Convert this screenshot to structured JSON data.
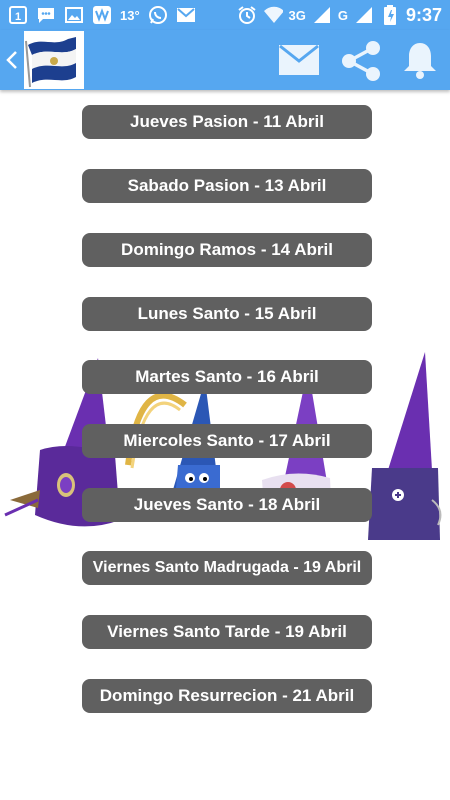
{
  "status_bar": {
    "notification_count": "1",
    "temperature": "13°",
    "network": "3G",
    "network2": "G",
    "time": "9:37",
    "icons": [
      "sim-notification-icon",
      "chat-icon",
      "image-icon",
      "news-app-icon",
      "whatsapp-icon",
      "gmail-icon",
      "alarm-icon",
      "wifi-icon",
      "signal-icon",
      "signal-icon",
      "battery-icon"
    ]
  },
  "app_bar": {
    "icons": [
      "back-arrow-icon",
      "el-salvador-flag-logo",
      "mail-icon",
      "share-icon",
      "bell-icon"
    ]
  },
  "days": [
    {
      "label": "Jueves Pasion - 11 Abril"
    },
    {
      "label": "Sabado Pasion - 13 Abril"
    },
    {
      "label": "Domingo Ramos - 14 Abril"
    },
    {
      "label": "Lunes Santo - 15 Abril"
    },
    {
      "label": "Martes Santo - 16 Abril"
    },
    {
      "label": "Miercoles Santo - 17 Abril"
    },
    {
      "label": "Jueves Santo - 18 Abril"
    },
    {
      "label": "Viernes Santo Madrugada - 19 Abril"
    },
    {
      "label": "Viernes Santo Tarde - 19 Abril"
    },
    {
      "label": "Domingo Resurrecion - 21 Abril"
    }
  ],
  "colors": {
    "primary": "#56a7f0",
    "button": "#606060",
    "button_text": "#ffffff",
    "nazareno_purple": "#6a2fb0",
    "nazareno_blue": "#2b57b5"
  }
}
